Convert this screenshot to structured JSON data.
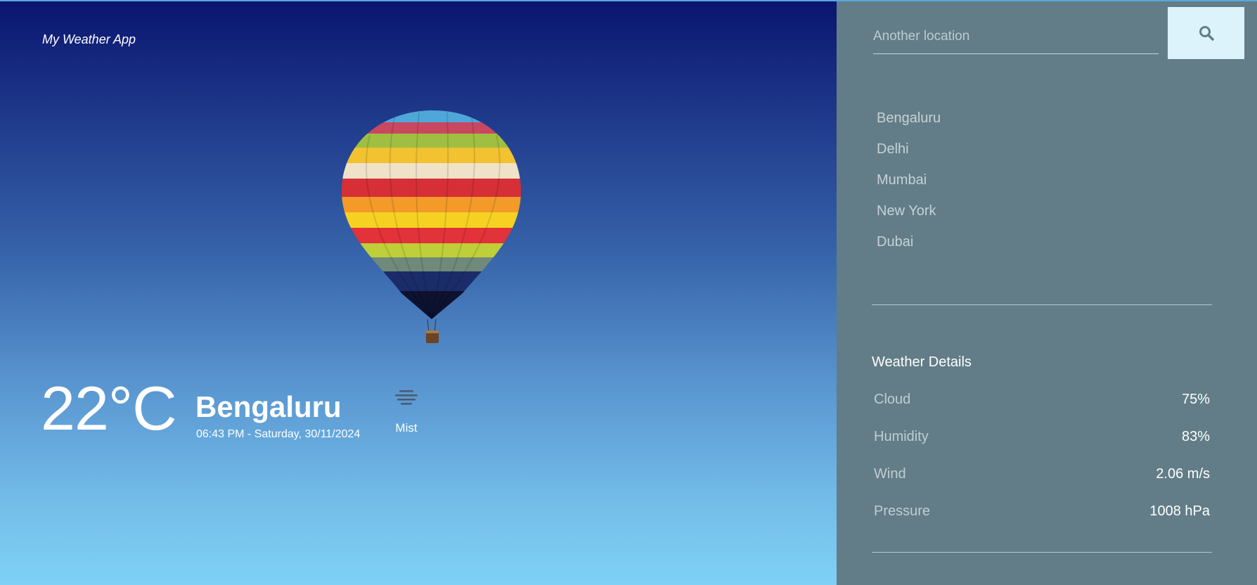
{
  "app": {
    "title": "My Weather App"
  },
  "current": {
    "temperature": "22°C",
    "city": "Bengaluru",
    "datetime": "06:43 PM - Saturday, 30/11/2024",
    "condition": "Mist",
    "condition_icon": "mist-icon"
  },
  "search": {
    "placeholder": "Another location",
    "value": "",
    "button_icon": "search-icon"
  },
  "locations": [
    "Bengaluru",
    "Delhi",
    "Mumbai",
    "New York",
    "Dubai"
  ],
  "details": {
    "title": "Weather Details",
    "rows": [
      {
        "label": "Cloud",
        "value": "75%"
      },
      {
        "label": "Humidity",
        "value": "83%"
      },
      {
        "label": "Wind",
        "value": "2.06 m/s"
      },
      {
        "label": "Pressure",
        "value": "1008 hPa"
      }
    ]
  },
  "colors": {
    "sky_top": "#0a1570",
    "sky_bottom": "#7fd1f6",
    "panel": "#627d87",
    "search_button": "#ddf3fb"
  }
}
